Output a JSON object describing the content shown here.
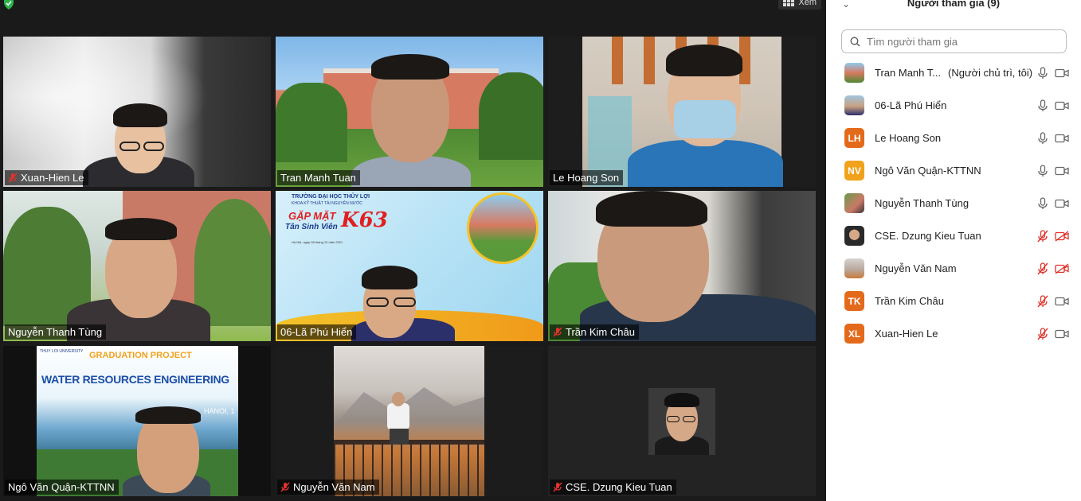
{
  "top_bar": {
    "view_label": "Xem"
  },
  "tiles": [
    {
      "name": "Xuan-Hien Le",
      "muted": true
    },
    {
      "name": "Tran Manh Tuan",
      "muted": false
    },
    {
      "name": "Le Hoang Son",
      "muted": false
    },
    {
      "name": "Nguyễn Thanh Tùng",
      "muted": false,
      "active_speaker": true
    },
    {
      "name": "06-Lã Phú Hiển",
      "muted": false
    },
    {
      "name": "Trần Kim Châu",
      "muted": true
    },
    {
      "name": "Ngô Văn Quận-KTTNN",
      "muted": false
    },
    {
      "name": "Nguyễn Văn Nam",
      "muted": true
    },
    {
      "name": "CSE. Dzung Kieu Tuan",
      "muted": true
    }
  ],
  "slides": {
    "k63_school": "TRƯỜNG ĐẠI HỌC THỦY LỢI",
    "k63_faculty": "KHOA KỸ THUẬT TÀI NGUYÊN NƯỚC",
    "k63_title": "GẶP MẶT",
    "k63_subtitle": "Tân Sinh Viên",
    "k63_code": "K63",
    "k63_date": "Hà Nội, ngày 08 tháng 10 năm 2021",
    "wre_uni": "THUY LOI UNIVERSITY",
    "wre_project": "GRADUATION PROJECT",
    "wre_title": "WATER RESOURCES ENGINEERING",
    "wre_city": "HANOI, 1"
  },
  "sidebar": {
    "title": "Người tham gia (9)",
    "search_placeholder": "Tìm người tham gia",
    "participants": [
      {
        "name": "Tran Manh T...",
        "role": "(Người chủ trì, tôi)",
        "avatar": "photo",
        "mic": "on",
        "cam": "on"
      },
      {
        "name": "06-Lã Phú Hiển",
        "role": "",
        "avatar": "photo",
        "mic": "on",
        "cam": "on"
      },
      {
        "name": "Le Hoang Son",
        "role": "",
        "initials": "LH",
        "mic": "on",
        "cam": "on"
      },
      {
        "name": "Ngô Văn Quận-KTTNN",
        "role": "",
        "initials": "NV",
        "mic": "on",
        "cam": "on"
      },
      {
        "name": "Nguyễn Thanh Tùng",
        "role": "",
        "avatar": "photo",
        "mic": "on",
        "cam": "on"
      },
      {
        "name": "CSE. Dzung Kieu Tuan",
        "role": "",
        "avatar": "photo",
        "mic": "off",
        "cam": "off"
      },
      {
        "name": "Nguyễn Văn Nam",
        "role": "",
        "avatar": "photo",
        "mic": "off",
        "cam": "off"
      },
      {
        "name": "Trần Kim Châu",
        "role": "",
        "initials": "TK",
        "mic": "off",
        "cam": "on"
      },
      {
        "name": "Xuan-Hien Le",
        "role": "",
        "initials": "XL",
        "mic": "off",
        "cam": "on"
      }
    ]
  },
  "colors": {
    "active_border": "#c9e33a",
    "avatar_orange": "#e46a1b",
    "avatar_amber": "#f0a21d",
    "mute_red": "#e0332b"
  }
}
